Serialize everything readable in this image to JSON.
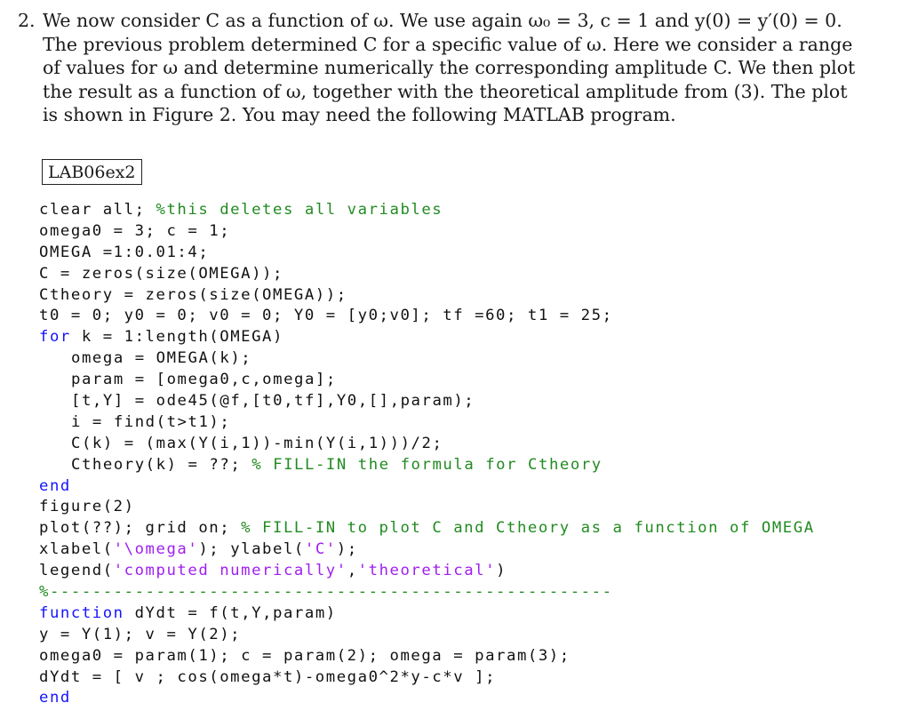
{
  "problem": {
    "number": "2.",
    "lines": [
      "We now consider C as a function of ω. We use again ω₀ = 3, c = 1 and y(0) = y′(0) = 0.",
      "The previous problem determined C for a specific value of ω. Here we consider a range",
      "of values for ω and determine numerically the corresponding amplitude C. We then plot",
      "the result as a function of ω, together with the theoretical amplitude from (3). The plot",
      "is shown in Figure 2. You may need the following MATLAB program."
    ]
  },
  "program_label": "LAB06ex2",
  "code": [
    {
      "indent": 0,
      "tokens": [
        {
          "t": "clear all; ",
          "c": "plain"
        },
        {
          "t": "%this deletes all variables",
          "c": "comment"
        }
      ]
    },
    {
      "indent": 0,
      "tokens": [
        {
          "t": "omega0 = 3; c = 1;",
          "c": "plain"
        }
      ]
    },
    {
      "indent": 0,
      "tokens": [
        {
          "t": "OMEGA =1:0.01:4;",
          "c": "plain"
        }
      ]
    },
    {
      "indent": 0,
      "tokens": [
        {
          "t": "C = zeros(size(OMEGA));",
          "c": "plain"
        }
      ]
    },
    {
      "indent": 0,
      "tokens": [
        {
          "t": "Ctheory = zeros(size(OMEGA));",
          "c": "plain"
        }
      ]
    },
    {
      "indent": 0,
      "tokens": [
        {
          "t": "t0 = 0; y0 = 0; v0 = 0; Y0 = [y0;v0]; tf =60; t1 = 25;",
          "c": "plain"
        }
      ]
    },
    {
      "indent": 0,
      "tokens": [
        {
          "t": "for",
          "c": "keyword"
        },
        {
          "t": " k = 1:length(OMEGA)",
          "c": "plain"
        }
      ]
    },
    {
      "indent": 1,
      "tokens": [
        {
          "t": "omega = OMEGA(k);",
          "c": "plain"
        }
      ]
    },
    {
      "indent": 1,
      "tokens": [
        {
          "t": "param = [omega0,c,omega];",
          "c": "plain"
        }
      ]
    },
    {
      "indent": 1,
      "tokens": [
        {
          "t": "[t,Y] = ode45(@f,[t0,tf],Y0,[],param);",
          "c": "plain"
        }
      ]
    },
    {
      "indent": 1,
      "tokens": [
        {
          "t": "i = find(t>t1);",
          "c": "plain"
        }
      ]
    },
    {
      "indent": 1,
      "tokens": [
        {
          "t": "C(k) = (max(Y(i,1))-min(Y(i,1)))/2;",
          "c": "plain"
        }
      ]
    },
    {
      "indent": 1,
      "tokens": [
        {
          "t": "Ctheory(k) = ??; ",
          "c": "plain"
        },
        {
          "t": "% FILL-IN the formula for Ctheory",
          "c": "comment"
        }
      ]
    },
    {
      "indent": 0,
      "tokens": [
        {
          "t": "end",
          "c": "keyword"
        }
      ]
    },
    {
      "indent": 0,
      "tokens": [
        {
          "t": "figure(2)",
          "c": "plain"
        }
      ]
    },
    {
      "indent": 0,
      "tokens": [
        {
          "t": "plot(??); grid on; ",
          "c": "plain"
        },
        {
          "t": "% FILL-IN to plot C and Ctheory as a function of OMEGA",
          "c": "comment"
        }
      ]
    },
    {
      "indent": 0,
      "tokens": [
        {
          "t": "xlabel(",
          "c": "plain"
        },
        {
          "t": "'\\omega'",
          "c": "string"
        },
        {
          "t": "); ylabel(",
          "c": "plain"
        },
        {
          "t": "'C'",
          "c": "string"
        },
        {
          "t": ");",
          "c": "plain"
        }
      ]
    },
    {
      "indent": 0,
      "tokens": [
        {
          "t": "legend(",
          "c": "plain"
        },
        {
          "t": "'computed numerically'",
          "c": "string"
        },
        {
          "t": ",",
          "c": "plain"
        },
        {
          "t": "'theoretical'",
          "c": "string"
        },
        {
          "t": ")",
          "c": "plain"
        }
      ]
    },
    {
      "indent": 0,
      "tokens": [
        {
          "t": "%-----------------------------------------------------",
          "c": "comment"
        }
      ]
    },
    {
      "indent": 0,
      "tokens": [
        {
          "t": "function",
          "c": "keyword"
        },
        {
          "t": " dYdt = f(t,Y,param)",
          "c": "plain"
        }
      ]
    },
    {
      "indent": 0,
      "tokens": [
        {
          "t": "y = Y(1); v = Y(2);",
          "c": "plain"
        }
      ]
    },
    {
      "indent": 0,
      "tokens": [
        {
          "t": "omega0 = param(1); c = param(2); omega = param(3);",
          "c": "plain"
        }
      ]
    },
    {
      "indent": 0,
      "tokens": [
        {
          "t": "dYdt = [ v ; cos(omega*t)-omega0^2*y-c*v ];",
          "c": "plain"
        }
      ]
    },
    {
      "indent": 0,
      "tokens": [
        {
          "t": "end",
          "c": "keyword"
        }
      ]
    }
  ],
  "colors": {
    "keyword": "#1414ff",
    "comment": "#228b22",
    "string": "#a020f0",
    "text": "#111111"
  }
}
